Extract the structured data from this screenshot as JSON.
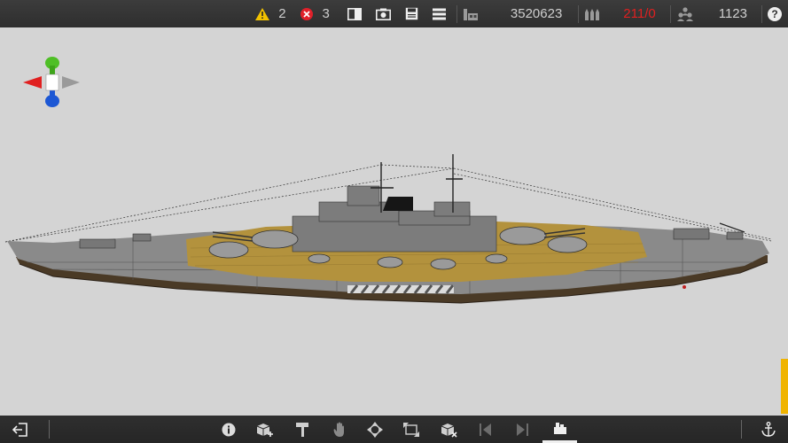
{
  "topbar": {
    "warnings": "2",
    "errors": "3",
    "cost": "3520623",
    "ammo": "211/0",
    "crew": "1123",
    "help_label": "?"
  },
  "icons": {
    "warning": "warning-icon",
    "error": "error-icon",
    "split": "split-view-icon",
    "camera": "camera-icon",
    "save": "save-icon",
    "menu": "menu-icon",
    "cost": "cost-icon",
    "ammo": "ammo-icon",
    "crew": "crew-icon",
    "help": "help-icon"
  },
  "colors": {
    "bar": "#2e2e2e",
    "accent": "#f0b400",
    "alert_red": "#e02020",
    "background": "#d4d4d4"
  },
  "bottombar": {
    "tools": [
      "exit",
      "info",
      "add-part",
      "paint",
      "hand",
      "move",
      "resize",
      "delete-part",
      "prev",
      "next",
      "components",
      "anchor"
    ],
    "active_tool": "components"
  }
}
